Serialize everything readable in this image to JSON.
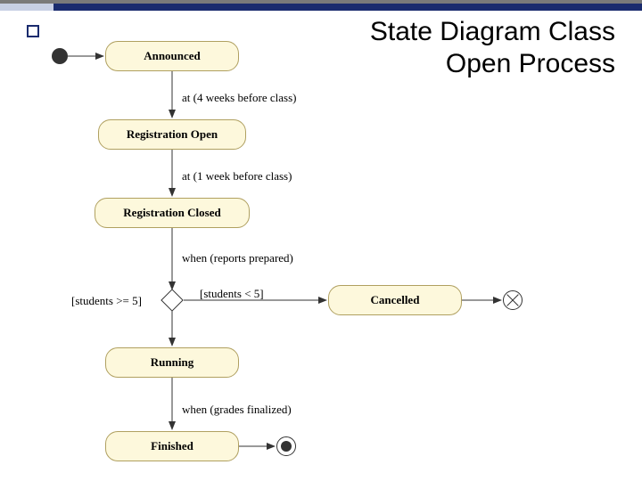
{
  "title_line1": "State Diagram  Class",
  "title_line2": "Open Process",
  "states": {
    "announced": "Announced",
    "reg_open": "Registration Open",
    "reg_closed": "Registration Closed",
    "cancelled": "Cancelled",
    "running": "Running",
    "finished": "Finished"
  },
  "transitions": {
    "t1": "at (4 weeks before class)",
    "t2": "at (1 week before class)",
    "t3": "when (reports prepared)",
    "guard_ge5": "[students >= 5]",
    "guard_lt5": "[students < 5]",
    "t4": "when (grades finalized)"
  },
  "chart_data": {
    "type": "state-diagram",
    "initial": "Announced",
    "states": [
      "Announced",
      "Registration Open",
      "Registration Closed",
      "Cancelled",
      "Running",
      "Finished"
    ],
    "final_states": [
      "Finished"
    ],
    "terminate_states": [
      "Cancelled"
    ],
    "transitions": [
      {
        "from": "__initial__",
        "to": "Announced",
        "label": ""
      },
      {
        "from": "Announced",
        "to": "Registration Open",
        "label": "at (4 weeks before class)"
      },
      {
        "from": "Registration Open",
        "to": "Registration Closed",
        "label": "at (1 week before class)"
      },
      {
        "from": "Registration Closed",
        "to": "__decision__",
        "label": "when (reports prepared)"
      },
      {
        "from": "__decision__",
        "to": "Running",
        "label": "[students >= 5]"
      },
      {
        "from": "__decision__",
        "to": "Cancelled",
        "label": "[students < 5]"
      },
      {
        "from": "Cancelled",
        "to": "__terminate__",
        "label": ""
      },
      {
        "from": "Running",
        "to": "Finished",
        "label": "when (grades finalized)"
      },
      {
        "from": "Finished",
        "to": "__final__",
        "label": ""
      }
    ]
  }
}
